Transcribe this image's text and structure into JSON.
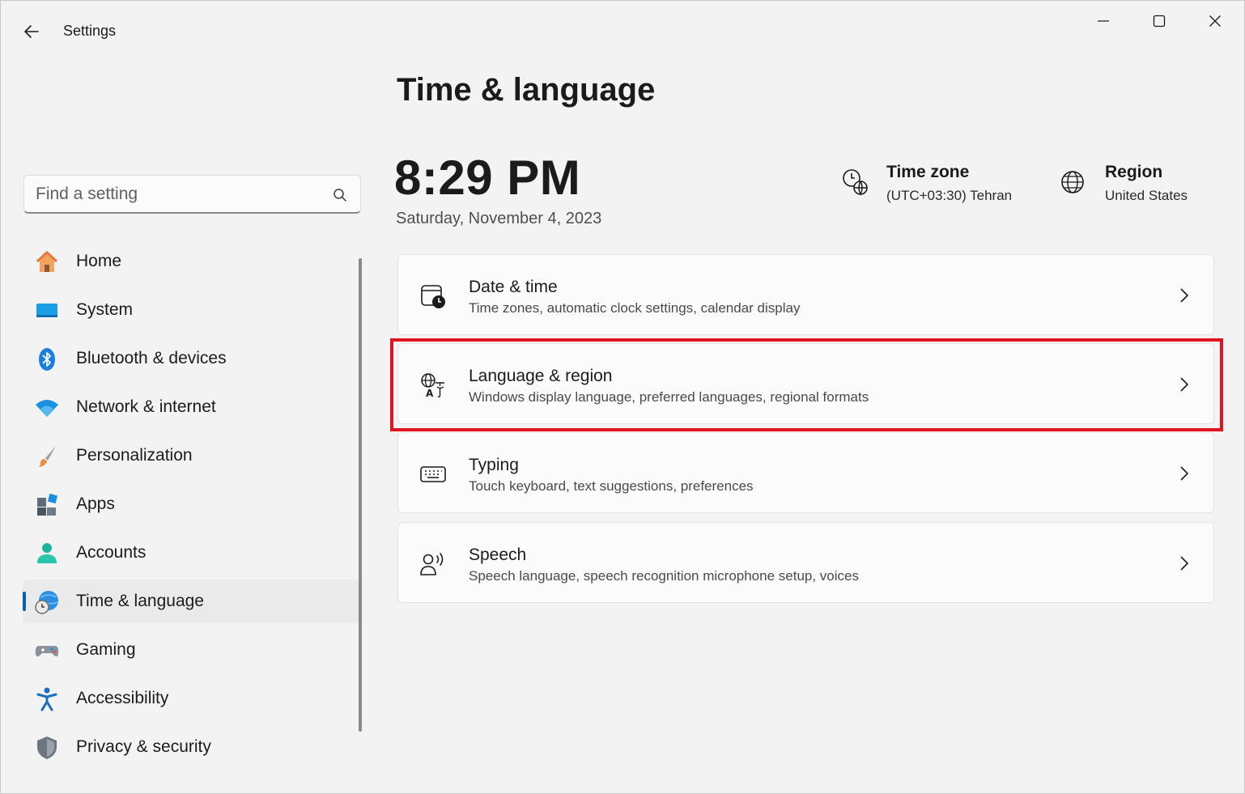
{
  "window": {
    "title": "Settings"
  },
  "search": {
    "placeholder": "Find a setting"
  },
  "sidebar": {
    "items": [
      {
        "label": "Home",
        "icon": "home-icon"
      },
      {
        "label": "System",
        "icon": "system-icon"
      },
      {
        "label": "Bluetooth & devices",
        "icon": "bluetooth-icon"
      },
      {
        "label": "Network & internet",
        "icon": "network-icon"
      },
      {
        "label": "Personalization",
        "icon": "brush-icon"
      },
      {
        "label": "Apps",
        "icon": "apps-icon"
      },
      {
        "label": "Accounts",
        "icon": "accounts-icon"
      },
      {
        "label": "Time & language",
        "icon": "globe-clock-icon",
        "active": true
      },
      {
        "label": "Gaming",
        "icon": "gamepad-icon"
      },
      {
        "label": "Accessibility",
        "icon": "accessibility-icon"
      },
      {
        "label": "Privacy & security",
        "icon": "shield-icon"
      }
    ]
  },
  "main": {
    "title": "Time & language",
    "time": "8:29 PM",
    "date": "Saturday, November 4, 2023",
    "time_zone": {
      "label": "Time zone",
      "value": "(UTC+03:30) Tehran"
    },
    "region": {
      "label": "Region",
      "value": "United States"
    },
    "cards": [
      {
        "title": "Date & time",
        "desc": "Time zones, automatic clock settings, calendar display",
        "icon": "calendar-clock-icon"
      },
      {
        "title": "Language & region",
        "desc": "Windows display language, preferred languages, regional formats",
        "icon": "language-icon",
        "highlighted": true
      },
      {
        "title": "Typing",
        "desc": "Touch keyboard, text suggestions, preferences",
        "icon": "keyboard-icon"
      },
      {
        "title": "Speech",
        "desc": "Speech language, speech recognition microphone setup, voices",
        "icon": "speech-icon"
      }
    ]
  },
  "colors": {
    "accent": "#005fb8",
    "highlight": "#e0141e",
    "background": "#f3f3f3"
  }
}
